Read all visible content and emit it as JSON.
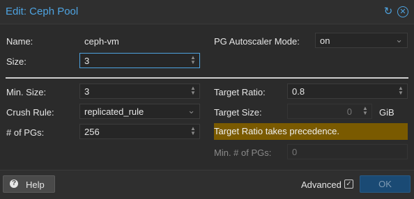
{
  "dialog": {
    "title": "Edit: Ceph Pool",
    "refresh_icon": "refresh-icon",
    "close_icon": "close-icon"
  },
  "form": {
    "name_label": "Name:",
    "name_value": "ceph-vm",
    "size_label": "Size:",
    "size_value": "3",
    "autoscaler_label": "PG Autoscaler Mode:",
    "autoscaler_value": "on",
    "min_size_label": "Min. Size:",
    "min_size_value": "3",
    "crush_rule_label": "Crush Rule:",
    "crush_rule_value": "replicated_rule",
    "pgs_label": "# of PGs:",
    "pgs_value": "256",
    "target_ratio_label": "Target Ratio:",
    "target_ratio_value": "0.8",
    "target_size_label": "Target Size:",
    "target_size_value": "0",
    "target_size_unit": "GiB",
    "notice": "Target Ratio takes precedence.",
    "min_pgs_label": "Min. # of PGs:",
    "min_pgs_value": "0"
  },
  "footer": {
    "help_label": "Help",
    "advanced_label": "Advanced",
    "advanced_checked": true,
    "ok_label": "OK"
  },
  "colors": {
    "accent": "#4ea3e0",
    "notice_bg": "#7a5a00",
    "ok_button": "#1a4a74"
  }
}
